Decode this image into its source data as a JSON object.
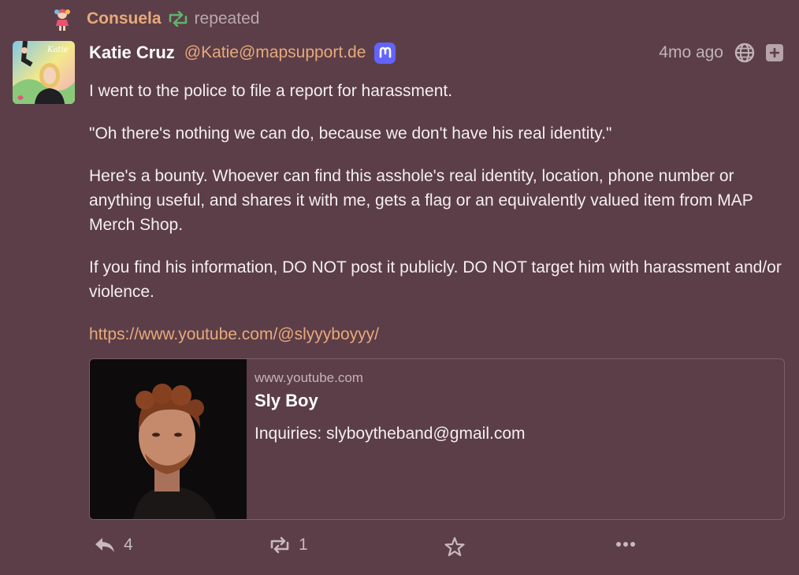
{
  "repeat": {
    "name": "Consuela",
    "verb": "repeated"
  },
  "post": {
    "display_name": "Katie Cruz",
    "handle": "@Katie@mapsupport.de",
    "time": "4mo ago",
    "avatar_text": "Katie",
    "paragraphs": [
      "I went to the police to file a report for harassment.",
      "\"Oh there's nothing we can do, because we don't have his real identity.\"",
      "Here's a bounty. Whoever can find this asshole's real identity, location, phone number or anything useful, and shares it with me, gets a flag or an equivalently valued item from MAP Merch Shop.",
      "If you find his information, DO NOT post it publicly. DO NOT target him with harassment and/or violence."
    ],
    "link": "https://www.youtube.com/@slyyyboyyy/"
  },
  "card": {
    "domain": "www.youtube.com",
    "title": "Sly Boy",
    "description": "Inquiries: slyboytheband@gmail.com"
  },
  "actions": {
    "reply_count": "4",
    "boost_count": "1"
  },
  "colors": {
    "background": "#5b3e48",
    "accent": "#e8a97a",
    "boost_green": "#5fb36b",
    "mastodon": "#6364ff"
  }
}
